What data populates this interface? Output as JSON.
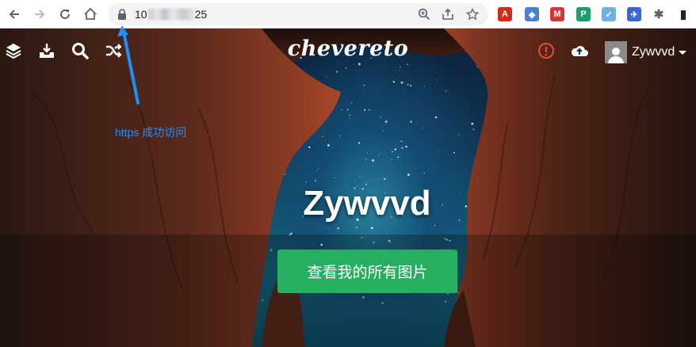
{
  "browser": {
    "url_prefix": "10",
    "url_suffix": "25",
    "icons": {
      "back": "arrow-left-icon",
      "forward": "arrow-right-icon",
      "reload": "reload-icon",
      "home": "home-icon",
      "lock": "lock-icon",
      "zoom": "zoom-icon",
      "share": "share-icon",
      "bookmark": "star-icon"
    },
    "extensions": [
      {
        "name": "acrobat-extension-icon",
        "color": "#d42a1d",
        "glyph": "A"
      },
      {
        "name": "graduation-extension-icon",
        "color": "#4a7fd4",
        "glyph": "◆"
      },
      {
        "name": "mendeley-extension-icon",
        "color": "#d4373a",
        "glyph": "M"
      },
      {
        "name": "p-extension-icon",
        "color": "#1a9c6b",
        "glyph": "P"
      },
      {
        "name": "check-extension-icon",
        "color": "#6fb2e2",
        "glyph": "✓"
      },
      {
        "name": "bird-extension-icon",
        "color": "#3a66d8",
        "glyph": "✈"
      },
      {
        "name": "puzzle-extension-icon",
        "color": "#5f6368",
        "glyph": "✱"
      },
      {
        "name": "sidepanel-icon",
        "color": "#202124",
        "glyph": "▮"
      }
    ]
  },
  "site": {
    "logo": "chevereto",
    "icons": {
      "layers": "layers-icon",
      "upload": "upload-tray-icon",
      "search": "search-icon",
      "random": "shuffle-icon",
      "alert": "alert-circle-icon",
      "cloud": "cloud-upload-icon"
    },
    "user": {
      "name": "Zywvvd"
    },
    "colors": {
      "alert": "#e74c3c",
      "button": "#27ae60",
      "annotation": "#1e90ff"
    }
  },
  "annotation": {
    "text": "https 成功访问"
  },
  "hero": {
    "title": "Zywvvd",
    "button_label": "查看我的所有图片"
  }
}
